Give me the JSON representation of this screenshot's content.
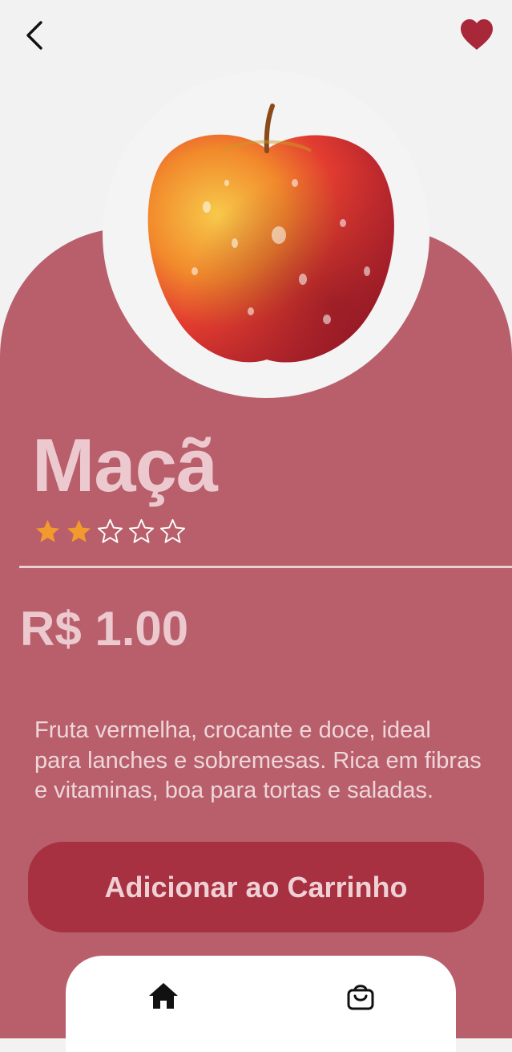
{
  "header": {
    "back_icon": "chevron-left-icon",
    "favorite_icon": "heart-icon",
    "favorite_color": "#a8283a"
  },
  "product": {
    "image_icon": "apple-image",
    "name": "Maçã",
    "rating": 2,
    "rating_max": 5,
    "star_color": "#f29a2e",
    "price": "R$ 1.00",
    "description": "Fruta vermelha, crocante e doce, ideal para lanches e sobremesas. Rica em fibras e vitaminas, boa para tortas e saladas."
  },
  "actions": {
    "add_to_cart_label": "Adicionar ao Carrinho"
  },
  "bottom_nav": {
    "items": [
      {
        "icon": "home-icon"
      },
      {
        "icon": "shopping-bag-icon"
      }
    ]
  },
  "colors": {
    "background": "#f2f2f2",
    "panel": "#b85f6b",
    "button": "#a73141",
    "text_light": "#ecc9cf"
  }
}
